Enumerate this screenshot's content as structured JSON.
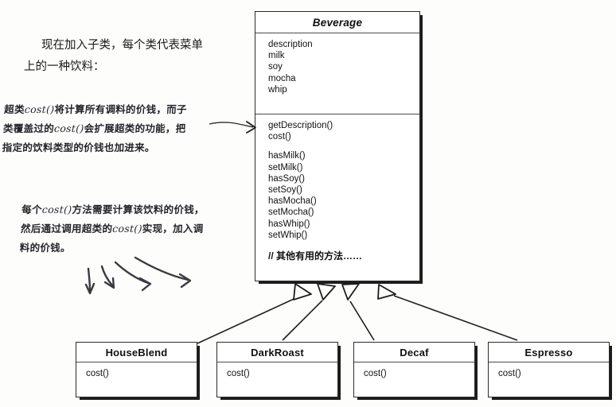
{
  "diagram": {
    "type": "uml-class-diagram",
    "superclass": {
      "name": "Beverage",
      "abstract": true,
      "attributes": [
        "description",
        "milk",
        "soy",
        "mocha",
        "whip"
      ],
      "methods_primary": [
        "getDescription()",
        "cost()"
      ],
      "methods_secondary": [
        "hasMilk()",
        "setMilk()",
        "hasSoy()",
        "setSoy()",
        "hasMocha()",
        "setMocha()",
        "hasWhip()",
        "setWhip()"
      ],
      "comment": "// 其他有用的方法……"
    },
    "subclasses": [
      {
        "name": "HouseBlend",
        "methods": [
          "cost()"
        ]
      },
      {
        "name": "DarkRoast",
        "methods": [
          "cost()"
        ]
      },
      {
        "name": "Decaf",
        "methods": [
          "cost()"
        ]
      },
      {
        "name": "Espresso",
        "methods": [
          "cost()"
        ]
      }
    ]
  },
  "captions": {
    "intro_line1": "现在加入子类，每个类代表菜单",
    "intro_line2": "上的一种饮料：",
    "note_superclass_cost": {
      "line1_a": "超类",
      "line1_code": "cost()",
      "line1_b": "将计算所有调料的价钱，而子",
      "line2_a": "类覆盖过的",
      "line2_code": "cost()",
      "line2_b": "会扩展超类的功能，把",
      "line3": "指定的饮料类型的价钱也加进来。"
    },
    "note_each_cost": {
      "line1_a": "每个",
      "line1_code": "cost()",
      "line1_b": "方法需要计算该饮料的价钱，",
      "line2_a": "然后通过调用超类的",
      "line2_code": "cost()",
      "line2_b": "实现，加入调",
      "line3": "料的价钱。"
    }
  },
  "colors": {
    "ink": "#1c1c1c",
    "box_border": "#2b2b2b",
    "divider": "#4a4a4a",
    "page_bg": "#fdfdfb",
    "handwriting": "#24242c"
  },
  "icons": {
    "inheritance_arrow": "hollow-triangle-arrowhead",
    "pointer_arrow": "thin-arrow",
    "sketch_arrow": "curved-hand-arrow"
  }
}
